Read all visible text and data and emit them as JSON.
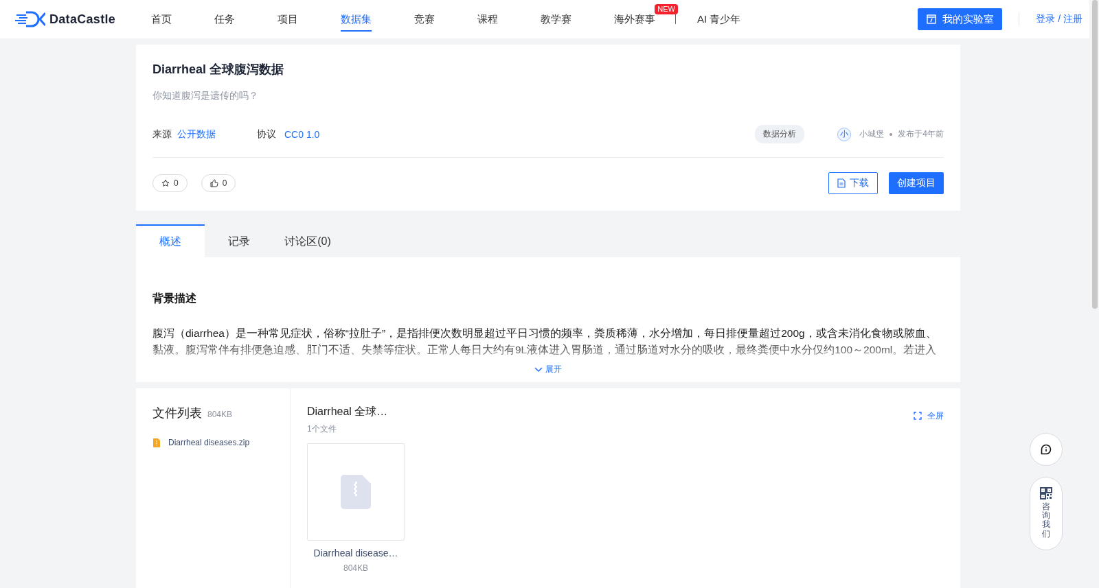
{
  "header": {
    "logo": "DataCastle",
    "nav": [
      {
        "label": "首页",
        "selected": false
      },
      {
        "label": "任务",
        "selected": false
      },
      {
        "label": "项目",
        "selected": false
      },
      {
        "label": "数据集",
        "selected": true
      },
      {
        "label": "竞赛",
        "selected": false
      },
      {
        "label": "课程",
        "selected": false
      },
      {
        "label": "教学赛",
        "selected": false
      },
      {
        "label": "海外赛事",
        "selected": false,
        "badge": "NEW"
      },
      {
        "label": "AI 青少年",
        "selected": false
      }
    ],
    "lab_button": "我的实验室",
    "login": "登录 / 注册"
  },
  "dataset": {
    "title": "Diarrheal 全球腹泻数据",
    "subtitle": "你知道腹泻是遗传的吗？",
    "source_label": "来源",
    "source": "公开数据",
    "license_label": "协议",
    "license": "CC0 1.0",
    "tag": "数据分析",
    "avatar": "小",
    "author": "小城堡",
    "published": "发布于4年前",
    "stars": "0",
    "likes": "0",
    "download": "下载",
    "create": "创建项目"
  },
  "tabs": [
    {
      "label": "概述",
      "selected": true
    },
    {
      "label": "记录",
      "selected": false
    },
    {
      "label": "讨论区(0)",
      "selected": false
    }
  ],
  "overview": {
    "heading": "背景描述",
    "paragraph": "腹泻（diarrhea）是一种常见症状，俗称“拉肚子”，是指排便次数明显超过平日习惯的频率，粪质稀薄，水分增加，每日排便量超过200g，或含未消化食物或脓血、黏液。腹泻常伴有排便急迫感、肛门不适、失禁等症状。正常人每日大约有9L液体进入胃肠道，通过肠道对水分的吸收，最终粪便中水分仅约100～200ml。若进入",
    "expand": "展开"
  },
  "files": {
    "title": "文件列表",
    "size": "804KB",
    "items": [
      {
        "name": "Diarrheal diseases.zip"
      }
    ],
    "folder": "Diarrheal 全球…",
    "count": "1个文件",
    "fullscreen": "全屏",
    "cards": [
      {
        "name": "Diarrheal disease…",
        "size": "804KB"
      }
    ]
  },
  "float": {
    "consult": "咨询我们"
  }
}
